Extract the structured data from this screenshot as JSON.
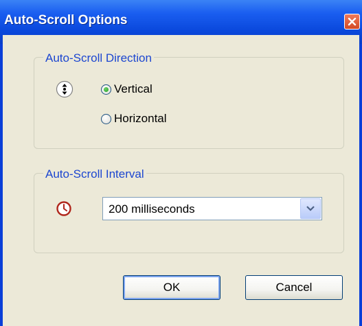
{
  "window": {
    "title": "Auto-Scroll Options"
  },
  "direction_group": {
    "legend": "Auto-Scroll Direction",
    "options": [
      {
        "label": "Vertical",
        "checked": true
      },
      {
        "label": "Horizontal",
        "checked": false
      }
    ]
  },
  "interval_group": {
    "legend": "Auto-Scroll Interval",
    "selected": "200 milliseconds"
  },
  "buttons": {
    "ok": "OK",
    "cancel": "Cancel"
  },
  "icons": {
    "close": "close-icon",
    "direction": "scroll-direction-icon",
    "interval": "clock-icon",
    "dropdown": "chevron-down-icon"
  },
  "colors": {
    "title_bar": "#0a48dc",
    "client": "#ece9d8",
    "legend_text": "#1c46d0",
    "close": "#d34a24"
  }
}
